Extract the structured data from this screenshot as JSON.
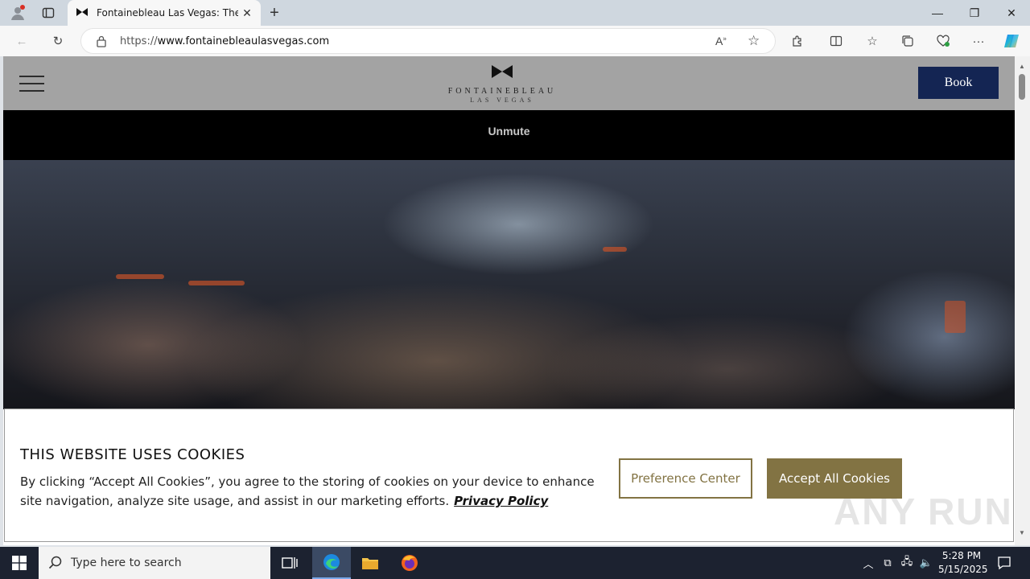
{
  "browser": {
    "tab_title": "Fontainebleau Las Vegas: The Bes",
    "url_prefix": "https://",
    "url_host": "www.fontainebleaulasvegas.com",
    "icons": [
      "profile-icon",
      "tab-actions-icon",
      "bowtie-favicon-icon",
      "close-icon",
      "new-tab-icon",
      "minimize-icon",
      "restore-icon",
      "window-close-icon",
      "back-icon",
      "refresh-icon",
      "lock-icon",
      "read-aloud-icon",
      "favorite-star-icon",
      "extensions-icon",
      "split-screen-icon",
      "favorites-icon",
      "collections-icon",
      "browser-essentials-icon",
      "more-icon",
      "copilot-icon"
    ]
  },
  "site": {
    "logo_main": "FONTAINEBLEAU",
    "logo_sub": "LAS VEGAS",
    "book_label": "Book",
    "unmute_label": "Unmute",
    "header_bg": "#a3a3a3",
    "book_bg": "#142553"
  },
  "cookie_banner": {
    "title": "THIS WEBSITE USES COOKIES",
    "body": "By clicking “Accept All Cookies”, you agree to the storing of cookies on your device to enhance site navigation, analyze site usage, and assist in our marketing efforts.",
    "privacy_link": "Privacy Policy",
    "preference_label": "Preference Center",
    "accept_label": "Accept All Cookies",
    "accent_color": "#827343"
  },
  "watermark": "ANY RUN",
  "taskbar": {
    "search_placeholder": "Type here to search",
    "time": "5:28 PM",
    "date": "5/15/2025"
  }
}
